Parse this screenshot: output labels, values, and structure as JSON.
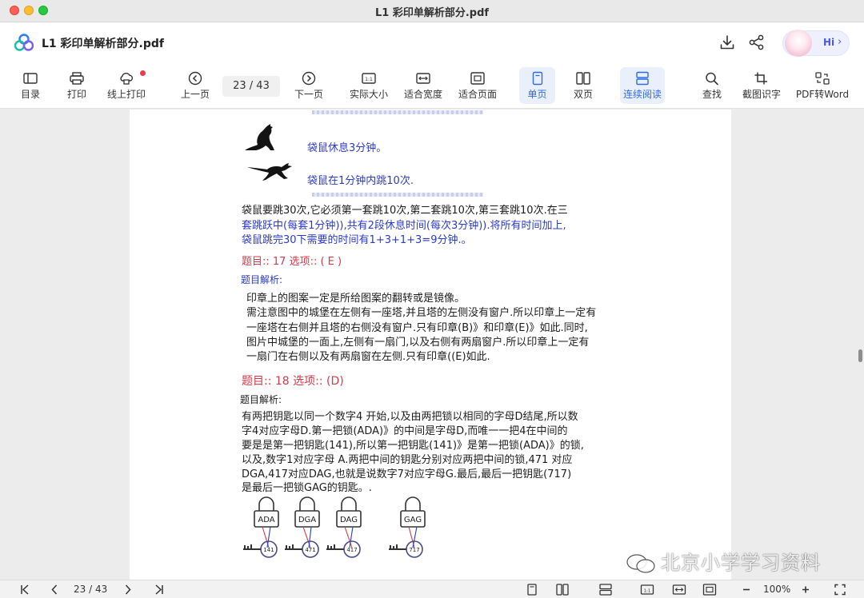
{
  "window": {
    "title": "L1 彩印单解析部分.pdf"
  },
  "header": {
    "doc_title": "L1 彩印单解析部分.pdf",
    "assistant_label": "Hi"
  },
  "toolbar": {
    "catalog": "目录",
    "print": "打印",
    "online_print": "线上打印",
    "prev_page": "上一页",
    "page_indicator": "23 / 43",
    "next_page": "下一页",
    "actual_size": "实际大小",
    "fit_width": "适合宽度",
    "fit_page": "适合页面",
    "single_page": "单页",
    "double_page": "双页",
    "continuous": "连续阅读",
    "find": "查找",
    "ocr": "截图识字",
    "pdf_to_word": "PDF转Word"
  },
  "document": {
    "legend_rest": "袋鼠休息3分钟。",
    "legend_jump": "袋鼠在1分钟内跳10次.",
    "q16_line1": "袋鼠要跳30次,它必须第一套跳10次,第二套跳10次,第三套跳10次.在三",
    "q16_line2": "套跳跃中(每套1分钟)),共有2段休息时间(每次3分钟)).将所有时间加上,",
    "q16_line3": "袋鼠跳完30下需要的时间有1+3+1+3=9分钟.。",
    "q17_title": "题目:: 17 选项:: ( E )",
    "q17_analysis_label": "题目解析:",
    "q17_line1": "印章上的图案一定是所给图案的翻转或是镜像。",
    "q17_line2": "需注意图中的城堡在左侧有一座塔,并且塔的左侧没有窗户.所以印章上一定有",
    "q17_line3": "一座塔在右侧并且塔的右侧没有窗户.只有印章(B)》和印章(E)》如此.同时,",
    "q17_line4": "图片中城堡的一面上,左侧有一扇门,以及右侧有两扇窗户.所以印章上一定有",
    "q17_line5": "一扇门在右侧以及有两扇窗在左侧.只有印章((E)如此.",
    "q18_title": "题目:: 18 选项:: (D)",
    "q18_analysis_label": "题目解析:",
    "q18_line1": "有两把钥匙以同一个数字4 开始,以及由两把锁以相同的字母D结尾,所以数",
    "q18_line2": "字4对应字母D.第一把锁(ADA)》的中间是字母D,而唯一一把4在中间的",
    "q18_line3": "要是是第一把钥匙(141),所以第一把钥匙(141)》是第一把锁(ADA)》的锁,",
    "q18_line4": "以及,数字1对应字母 A.两把中间的钥匙分别对应两把中间的锁,471 对应",
    "q18_line5": "DGA,417对应DAG,也就是说数字7对应字母G.最后,最后一把钥匙(717)",
    "q18_line6": "是最后一把锁GAG的钥匙。.",
    "locks": [
      "ADA",
      "DGA",
      "DAG",
      "GAG"
    ],
    "keys": [
      "141",
      "471",
      "417",
      "717"
    ]
  },
  "bottom": {
    "page_indicator": "23 / 43",
    "zoom": "100%"
  },
  "watermark": "北京小学学习资料",
  "colors": {
    "accent": "#2d6ae3",
    "scan_blue": "#2b3bc9",
    "scan_red": "#d53a47"
  }
}
